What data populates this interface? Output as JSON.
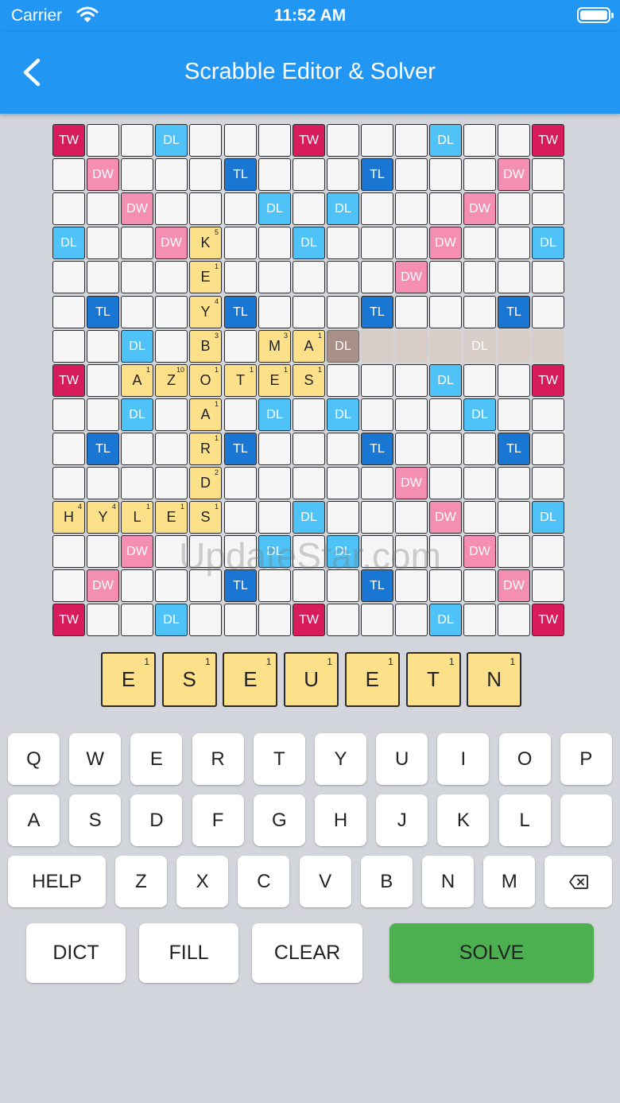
{
  "status_bar": {
    "carrier": "Carrier",
    "time": "11:52 AM"
  },
  "nav": {
    "title": "Scrabble Editor & Solver"
  },
  "board": {
    "premium_rows": [
      "TW . . DL . . . TW . . . DL . . TW",
      ". DW . . . TL . . . TL . . . DW .",
      ". . DW . . . DL . DL . . . DW . .",
      "DL . . DW . . . DL . . . DW . . DL",
      ". . . . DW . . . . . DW . . . .",
      ". TL . . . TL . . . TL . . . TL .",
      ". . DL . . . DL . DL . . . DL . .",
      "TW . . DL . . . . . . . DL . . TW",
      ". . DL . . . DL . DL . . . DL . .",
      ". TL . . . TL . . . TL . . . TL .",
      ". . . . DW . . . . . DW . . . .",
      "DL . . DW . . . DL . . . DW . . DL",
      ". . DW . . . DL . DL . . . DW . .",
      ". DW . . . TL . . . TL . . . DW .",
      "TW . . DL . . . TW . . . DL . . TW"
    ],
    "tiles": [
      {
        "row": 3,
        "col": 4,
        "letter": "K",
        "points": "5"
      },
      {
        "row": 4,
        "col": 4,
        "letter": "E",
        "points": "1"
      },
      {
        "row": 5,
        "col": 4,
        "letter": "Y",
        "points": "4"
      },
      {
        "row": 6,
        "col": 4,
        "letter": "B",
        "points": "3"
      },
      {
        "row": 6,
        "col": 6,
        "letter": "M",
        "points": "3"
      },
      {
        "row": 6,
        "col": 7,
        "letter": "A",
        "points": "1"
      },
      {
        "row": 7,
        "col": 2,
        "letter": "A",
        "points": "1"
      },
      {
        "row": 7,
        "col": 3,
        "letter": "Z",
        "points": "10"
      },
      {
        "row": 7,
        "col": 4,
        "letter": "O",
        "points": "1"
      },
      {
        "row": 7,
        "col": 5,
        "letter": "T",
        "points": "1"
      },
      {
        "row": 7,
        "col": 6,
        "letter": "E",
        "points": "1"
      },
      {
        "row": 7,
        "col": 7,
        "letter": "S",
        "points": "1"
      },
      {
        "row": 8,
        "col": 4,
        "letter": "A",
        "points": "1"
      },
      {
        "row": 9,
        "col": 4,
        "letter": "R",
        "points": "1"
      },
      {
        "row": 10,
        "col": 4,
        "letter": "D",
        "points": "2"
      },
      {
        "row": 11,
        "col": 0,
        "letter": "H",
        "points": "4"
      },
      {
        "row": 11,
        "col": 1,
        "letter": "Y",
        "points": "4"
      },
      {
        "row": 11,
        "col": 2,
        "letter": "L",
        "points": "1"
      },
      {
        "row": 11,
        "col": 3,
        "letter": "E",
        "points": "1"
      },
      {
        "row": 11,
        "col": 4,
        "letter": "S",
        "points": "1"
      }
    ],
    "selected_cell": {
      "row": 6,
      "col": 8
    },
    "highlight_row": 6,
    "highlight_cols": [
      9,
      10,
      11,
      12,
      13,
      14
    ]
  },
  "watermark": "UpdateStar.com",
  "rack": [
    {
      "letter": "E",
      "points": "1"
    },
    {
      "letter": "S",
      "points": "1"
    },
    {
      "letter": "E",
      "points": "1"
    },
    {
      "letter": "U",
      "points": "1"
    },
    {
      "letter": "E",
      "points": "1"
    },
    {
      "letter": "T",
      "points": "1"
    },
    {
      "letter": "N",
      "points": "1"
    }
  ],
  "keyboard": {
    "row1": [
      "Q",
      "W",
      "E",
      "R",
      "T",
      "Y",
      "U",
      "I",
      "O",
      "P"
    ],
    "row2": [
      "A",
      "S",
      "D",
      "F",
      "G",
      "H",
      "J",
      "K",
      "L",
      ""
    ],
    "row3": [
      "Z",
      "X",
      "C",
      "V",
      "B",
      "N",
      "M"
    ],
    "help": "HELP",
    "backspace_icon": "backspace-icon"
  },
  "actions": {
    "dict": "DICT",
    "fill": "FILL",
    "clear": "CLEAR",
    "solve": "SOLVE"
  },
  "colors": {
    "nav": "#2196f3",
    "TW": "#d81b5a",
    "DW": "#f48fb1",
    "TL": "#1976d2",
    "DL": "#4fc3f7",
    "tile": "#fde08a",
    "solve": "#4caf50",
    "background": "#d2d5db"
  }
}
